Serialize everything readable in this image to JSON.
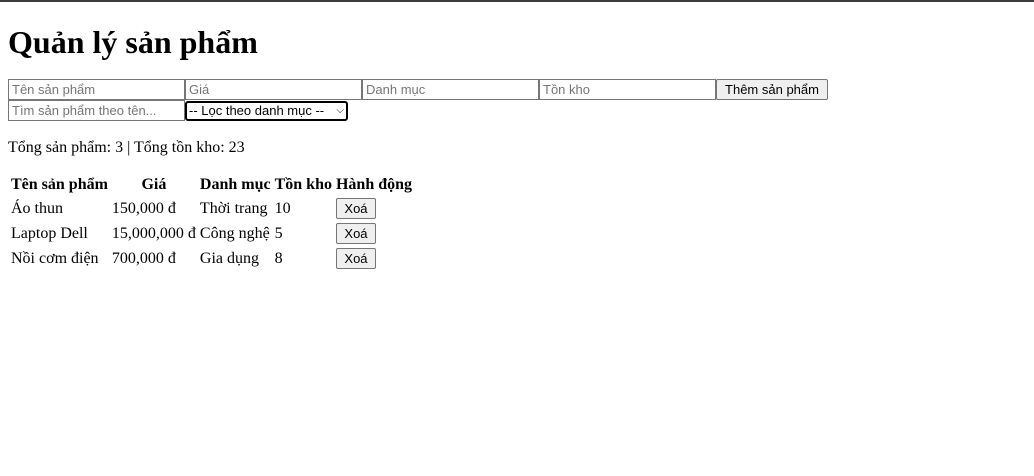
{
  "page_title": "Quản lý sản phẩm",
  "form": {
    "name_placeholder": "Tên sản phẩm",
    "price_placeholder": "Giá",
    "category_placeholder": "Danh mục",
    "stock_placeholder": "Tồn kho",
    "add_button": "Thêm sản phẩm"
  },
  "filter": {
    "search_placeholder": "Tìm sản phẩm theo tên...",
    "category_selected": "-- Lọc theo danh mục --"
  },
  "summary": "Tổng sản phẩm: 3 | Tổng tồn kho: 23",
  "table": {
    "headers": [
      "Tên sản phẩm",
      "Giá",
      "Danh mục",
      "Tồn kho",
      "Hành động"
    ],
    "rows": [
      {
        "name": "Áo thun",
        "price": "150,000 đ",
        "category": "Thời trang",
        "stock": "10",
        "action": "Xoá"
      },
      {
        "name": "Laptop Dell",
        "price": "15,000,000 đ",
        "category": "Công nghệ",
        "stock": "5",
        "action": "Xoá"
      },
      {
        "name": "Nồi cơm điện",
        "price": "700,000 đ",
        "category": "Gia dụng",
        "stock": "8",
        "action": "Xoá"
      }
    ]
  }
}
